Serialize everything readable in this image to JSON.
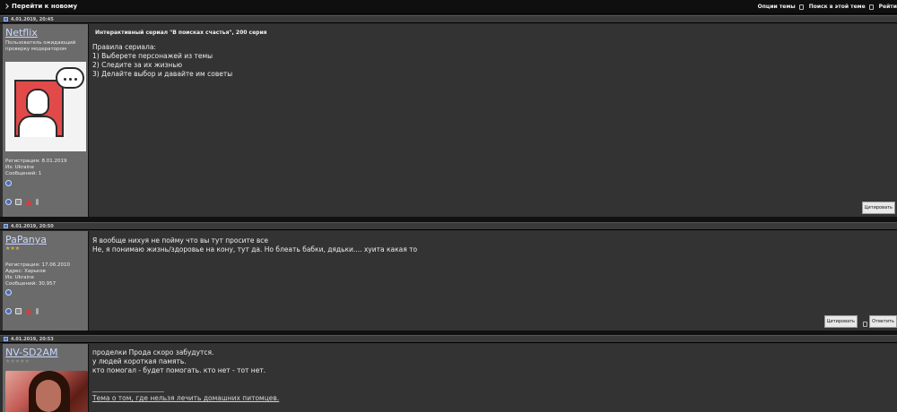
{
  "topbar": {
    "back_label": "Перейти к новому",
    "options_label": "Опции темы",
    "search_label": "Поиск в этой теме",
    "rating_label": "Рейти"
  },
  "posts": [
    {
      "date": "4.01.2019, 20:45",
      "username": "Netflix",
      "rank": "Пользователь ожидающий проверку модератором",
      "reg": "Регистрация: 8.01.2019",
      "from": "Из: Ukraine",
      "messages": "Сообщений: 1",
      "title": "Интерактивный сериал \"В поисках счастья\", 200 серия",
      "body": [
        "Правила сериала:",
        "1) Выберете персонажей из темы",
        "2) Следите за их жизнью",
        "3) Делайте выбор и давайте им советы"
      ],
      "quote_btn": "Цитировать"
    },
    {
      "date": "4.01.2019, 20:50",
      "username": "PaPanya",
      "stars": "★★★",
      "reg": "Регистрация: 17.06.2010",
      "address": "Адрес: Харьков",
      "from": "Из: Ukraine",
      "messages": "Сообщений: 30,957",
      "body": [
        "Я вообще нихуя не пойму что вы тут просите все",
        "Не, я понимаю жизнь/здоровье на кону, тут да. Но блеать бабки, дядьки.... хуита какая то"
      ],
      "quote_btn": "Цитировать",
      "reply_btn": "Ответить"
    },
    {
      "date": "4.01.2019, 20:53",
      "username": "NV-SD2AM",
      "stars": "★★★★★",
      "body": [
        "проделки Прода скоро забудутся.",
        "у людей короткая память.",
        "кто помогал - будет помогать. кто нет - тот нет."
      ],
      "signature": "Тема о том, где нельзя лечить домашних питомцев."
    }
  ]
}
